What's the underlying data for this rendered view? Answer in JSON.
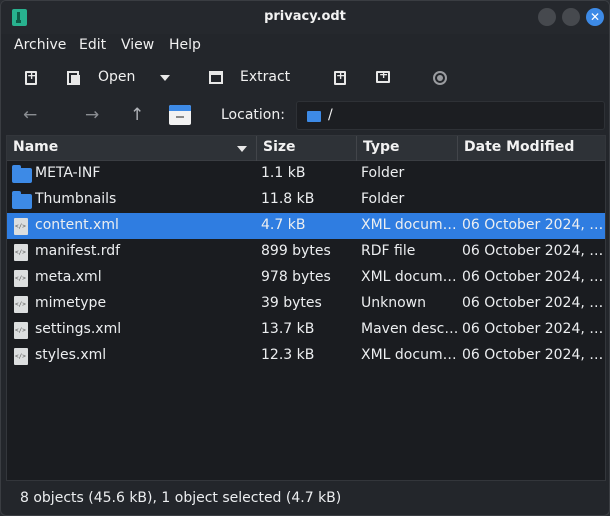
{
  "window": {
    "title": "privacy.odt"
  },
  "menu": [
    "Archive",
    "Edit",
    "View",
    "Help"
  ],
  "toolbar": {
    "open_label": "Open",
    "extract_label": "Extract"
  },
  "location": {
    "label": "Location:",
    "value": "/"
  },
  "columns": {
    "name": "Name",
    "size": "Size",
    "type": "Type",
    "date": "Date Modified"
  },
  "rows": [
    {
      "name": "META-INF",
      "size": "1.1 kB",
      "type": "Folder",
      "date": "",
      "icon": "folder-icon"
    },
    {
      "name": "Thumbnails",
      "size": "11.8 kB",
      "type": "Folder",
      "date": "",
      "icon": "folder-icon"
    },
    {
      "name": "content.xml",
      "size": "4.7 kB",
      "type": "XML docum…",
      "date": "06 October 2024, …",
      "icon": "xml-file-icon",
      "selected": true
    },
    {
      "name": "manifest.rdf",
      "size": "899 bytes",
      "type": "RDF file",
      "date": "06 October 2024, …",
      "icon": "rdf-file-icon"
    },
    {
      "name": "meta.xml",
      "size": "978 bytes",
      "type": "XML docum…",
      "date": "06 October 2024, …",
      "icon": "xml-file-icon"
    },
    {
      "name": "mimetype",
      "size": "39 bytes",
      "type": "Unknown",
      "date": "06 October 2024, …",
      "icon": "file-icon"
    },
    {
      "name": "settings.xml",
      "size": "13.7 kB",
      "type": "Maven desc…",
      "date": "06 October 2024, …",
      "icon": "text-file-icon"
    },
    {
      "name": "styles.xml",
      "size": "12.3 kB",
      "type": "XML docum…",
      "date": "06 October 2024, …",
      "icon": "xml-file-icon"
    }
  ],
  "status": "8 objects (45.6 kB), 1 object selected (4.7 kB)",
  "colors": {
    "selection": "#2f7de1",
    "folder": "#3d8ae6",
    "background": "#1a1c20"
  }
}
